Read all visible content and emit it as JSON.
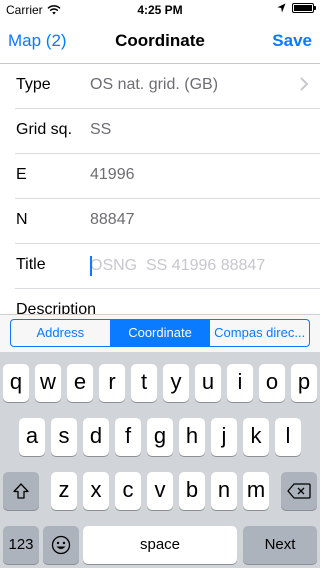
{
  "status": {
    "carrier": "Carrier",
    "time": "4:25 PM",
    "battery_level": 1.0
  },
  "nav": {
    "back_label": "Map (2)",
    "title": "Coordinate",
    "save_label": "Save"
  },
  "form": {
    "rows": [
      {
        "label": "Type",
        "value": "OS nat. grid. (GB)"
      },
      {
        "label": "Grid sq.",
        "value": "SS"
      },
      {
        "label": "E",
        "value": "41996"
      },
      {
        "label": "N",
        "value": "88847"
      },
      {
        "label": "Title",
        "placeholder": "OSNG  SS 41996 88847"
      },
      {
        "label": "Description"
      }
    ]
  },
  "segments": {
    "items": [
      "Address",
      "Coordinate",
      "Compas direc..."
    ],
    "selected": "Coordinate"
  },
  "keyboard": {
    "row1": [
      "q",
      "w",
      "e",
      "r",
      "t",
      "y",
      "u",
      "i",
      "o",
      "p"
    ],
    "row2": [
      "a",
      "s",
      "d",
      "f",
      "g",
      "h",
      "j",
      "k",
      "l"
    ],
    "row3": [
      "z",
      "x",
      "c",
      "v",
      "b",
      "n",
      "m"
    ],
    "numbers_label": "123",
    "space_label": "space",
    "next_label": "Next"
  },
  "colors": {
    "accent": "#0a7aff",
    "keyboard_bg": "#d1d4d9",
    "function_key": "#adb3bc"
  }
}
